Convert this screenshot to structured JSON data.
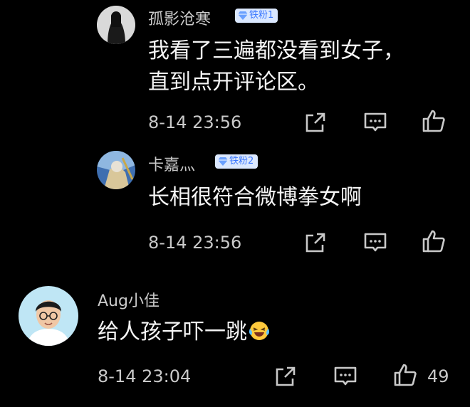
{
  "comments": [
    {
      "username": "孤影沧寒",
      "badge": "铁粉1",
      "text_line1": "我看了三遍都没看到女子，",
      "text_line2": "直到点开评论区。",
      "time": "8-14 23:56"
    },
    {
      "username": "卡嘉灬",
      "badge": "铁粉2",
      "text_line1": "长相很符合微博拳女啊",
      "time": "8-14 23:56"
    },
    {
      "username": "Aug小佳",
      "text_line1": "给人孩子吓一跳",
      "emoji": "laughing-crying-emoji",
      "time": "8-14 23:04",
      "like_count": "49"
    }
  ],
  "icons": [
    "share-icon",
    "reply-comment-icon",
    "like-thumb-icon",
    "diamond-icon"
  ],
  "colors": {
    "background": "#000000",
    "badge_bg": "#dbe8ff",
    "badge_text": "#3b78ff",
    "meta_text": "#c9c9c9"
  }
}
